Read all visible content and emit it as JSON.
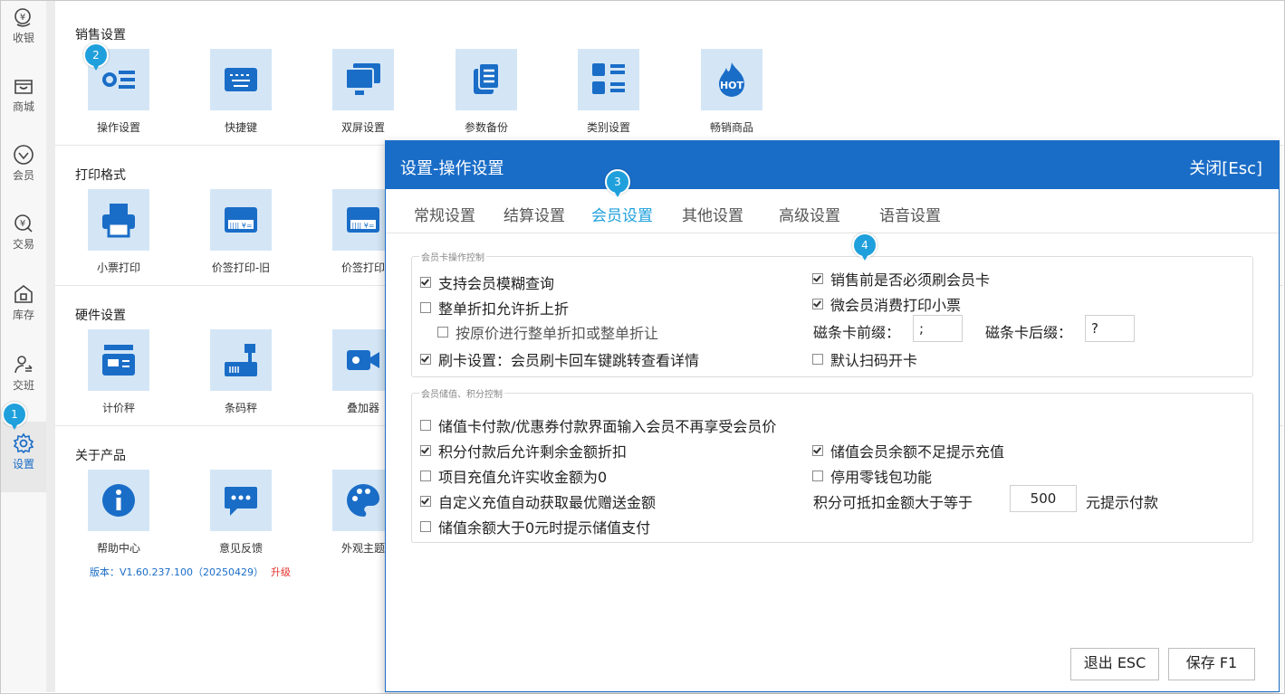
{
  "nav": {
    "items": [
      {
        "label": "收银"
      },
      {
        "label": "商城"
      },
      {
        "label": "会员"
      },
      {
        "label": "交易"
      },
      {
        "label": "库存"
      },
      {
        "label": "交班"
      },
      {
        "label": "设置"
      }
    ],
    "active": "设置"
  },
  "sections": {
    "sales": {
      "title": "销售设置",
      "tiles": [
        {
          "label": "操作设置"
        },
        {
          "label": "快捷键"
        },
        {
          "label": "双屏设置"
        },
        {
          "label": "参数备份"
        },
        {
          "label": "类别设置"
        },
        {
          "label": "畅销商品",
          "badge": "HOT"
        }
      ]
    },
    "print": {
      "title": "打印格式",
      "tiles": [
        {
          "label": "小票打印"
        },
        {
          "label": "价签打印-旧"
        },
        {
          "label": "价签打印"
        }
      ]
    },
    "hardware": {
      "title": "硬件设置",
      "tiles": [
        {
          "label": "计价秤"
        },
        {
          "label": "条码秤"
        },
        {
          "label": "叠加器"
        }
      ]
    },
    "about": {
      "title": "关于产品",
      "tiles": [
        {
          "label": "帮助中心"
        },
        {
          "label": "意见反馈"
        },
        {
          "label": "外观主题"
        }
      ]
    }
  },
  "version": {
    "text": "版本：V1.60.237.100（20250429）",
    "upgrade": "升级"
  },
  "markers": [
    "1",
    "2",
    "3",
    "4"
  ],
  "dialog": {
    "title": "设置-操作设置",
    "close": "关闭[Esc]",
    "tabs": [
      "常规设置",
      "结算设置",
      "会员设置",
      "其他设置",
      "高级设置",
      "语音设置"
    ],
    "active_tab": "会员设置",
    "group1": {
      "title": "会员卡操作控制",
      "left": [
        {
          "label": "支持会员模糊查询",
          "checked": true
        },
        {
          "label": "整单折扣允许折上折",
          "checked": false
        },
        {
          "label": "按原价进行整单折扣或整单折让",
          "checked": false
        },
        {
          "label": "刷卡设置：会员刷卡回车键跳转查看详情",
          "checked": true
        }
      ],
      "right": [
        {
          "label": "销售前是否必须刷会员卡",
          "checked": true
        },
        {
          "label": "微会员消费打印小票",
          "checked": true
        },
        {
          "label": "默认扫码开卡",
          "checked": false
        }
      ],
      "prefix_label": "磁条卡前缀：",
      "prefix_value": ";",
      "suffix_label": "磁条卡后缀：",
      "suffix_value": "?"
    },
    "group2": {
      "title": "会员储值、积分控制",
      "options": [
        {
          "label": "储值卡付款/优惠券付款界面输入会员不再享受会员价",
          "checked": false
        },
        {
          "label": "积分付款后允许剩余金额折扣",
          "checked": true
        },
        {
          "label": "项目充值允许实收金额为0",
          "checked": false
        },
        {
          "label": "自定义充值自动获取最优赠送金额",
          "checked": true
        },
        {
          "label": "储值余额大于0元时提示储值支付",
          "checked": false
        },
        {
          "label": "储值会员余额不足提示充值",
          "checked": true
        },
        {
          "label": "停用零钱包功能",
          "checked": false
        }
      ],
      "points_label": "积分可抵扣金额大于等于",
      "points_value": "500",
      "points_suffix": "元提示付款"
    },
    "buttons": {
      "exit": "退出 ESC",
      "save": "保存 F1"
    }
  },
  "colors": {
    "primary": "#1a6dc7",
    "active_tab": "#1fa0dc",
    "tile_bg": "#d4e6f6",
    "marker": "#1fa0dc",
    "upgrade": "#e0302c"
  }
}
